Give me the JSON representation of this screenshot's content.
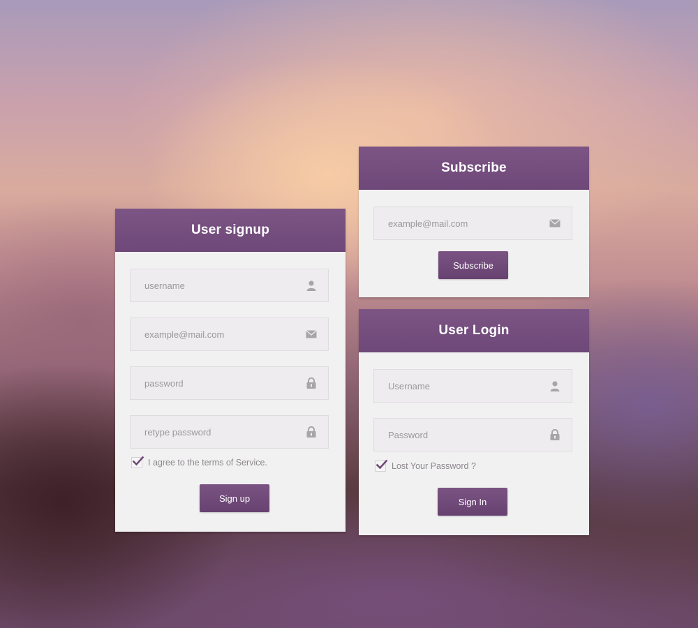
{
  "colors": {
    "header": "#75507f",
    "button": "#6f4a78",
    "card": "#f2f1f2",
    "field": "#eeecee",
    "icon": "#a8a5a9"
  },
  "signup": {
    "title": "User signup",
    "fields": [
      {
        "placeholder": "username",
        "icon": "user-icon"
      },
      {
        "placeholder": "example@mail.com",
        "icon": "mail-icon"
      },
      {
        "placeholder": "password",
        "icon": "lock-icon"
      },
      {
        "placeholder": "retype password",
        "icon": "lock-icon"
      }
    ],
    "terms_label": "I agree to the terms of Service.",
    "terms_checked": true,
    "button_label": "Sign up"
  },
  "subscribe": {
    "title": "Subscribe",
    "email_placeholder": "example@mail.com",
    "email_icon": "mail-icon",
    "button_label": "Subscribe"
  },
  "login": {
    "title": "User Login",
    "fields": [
      {
        "placeholder": "Username",
        "icon": "user-icon"
      },
      {
        "placeholder": "Password",
        "icon": "lock-icon"
      }
    ],
    "lost_password_label": "Lost Your Password ?",
    "lost_password_checked": true,
    "button_label": "Sign In"
  }
}
